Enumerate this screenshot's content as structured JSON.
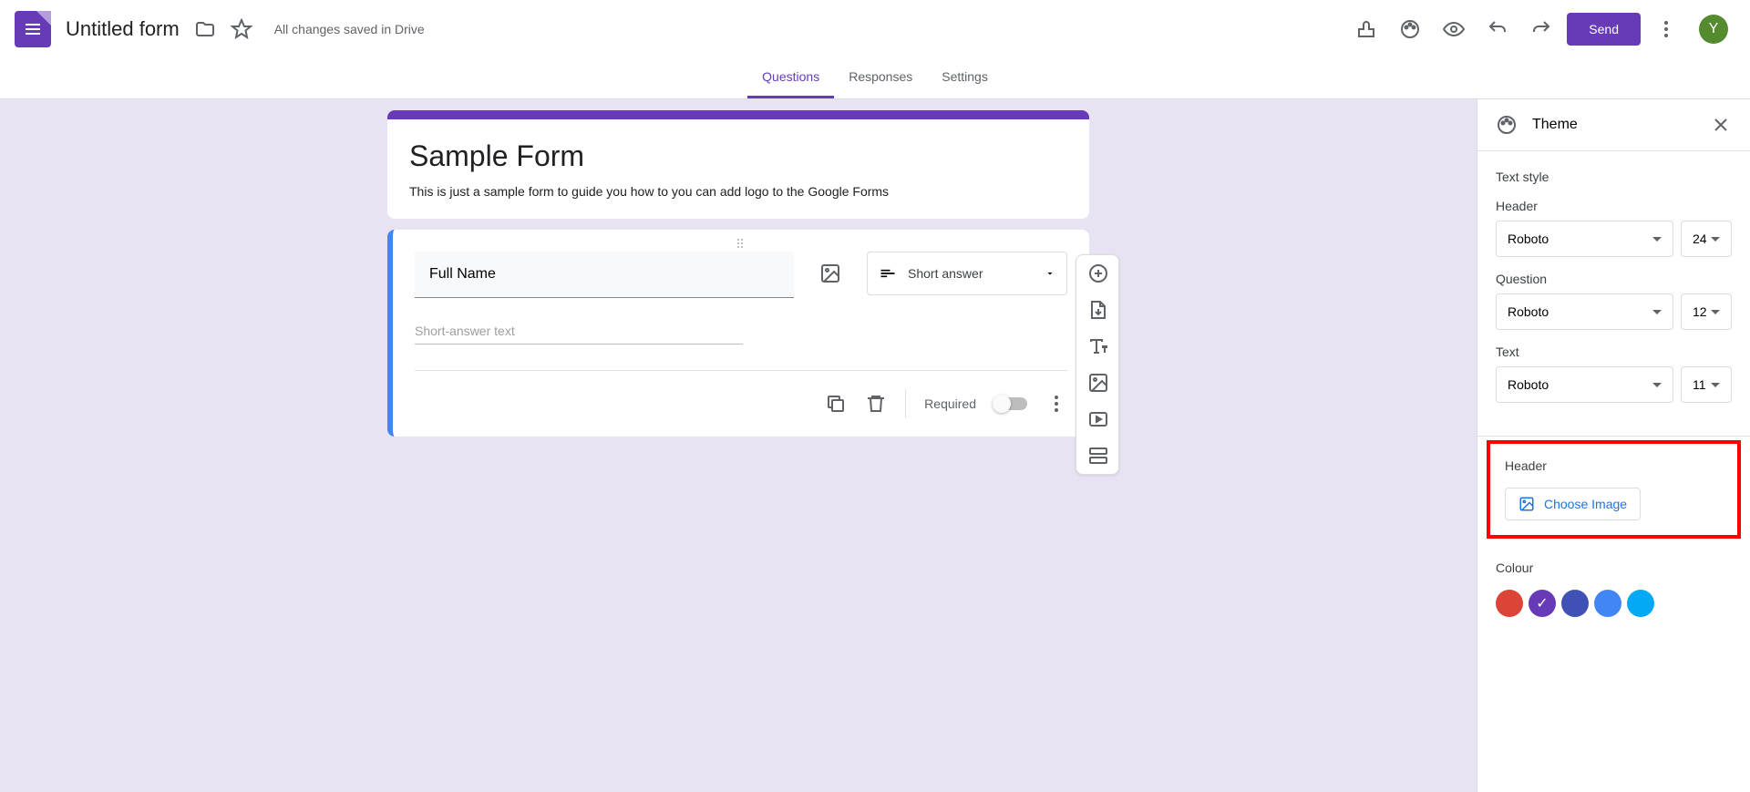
{
  "header": {
    "form_name": "Untitled form",
    "save_status": "All changes saved in Drive",
    "send_label": "Send",
    "avatar_letter": "Y"
  },
  "tabs": {
    "questions": "Questions",
    "responses": "Responses",
    "settings": "Settings"
  },
  "form": {
    "title": "Sample Form",
    "description": "This is just a sample form to guide you how to you can add logo to the Google Forms"
  },
  "question": {
    "label": "Full Name",
    "type": "Short answer",
    "placeholder": "Short-answer text",
    "required_label": "Required"
  },
  "theme": {
    "title": "Theme",
    "text_style_label": "Text style",
    "header_label": "Header",
    "header_font": "Roboto",
    "header_size": "24",
    "question_label": "Question",
    "question_font": "Roboto",
    "question_size": "12",
    "text_label": "Text",
    "text_font": "Roboto",
    "text_size": "11",
    "header_image_label": "Header",
    "choose_image": "Choose Image",
    "colour_label": "Colour",
    "swatch_colors": [
      "#db4437",
      "#673ab7",
      "#3f51b5",
      "#4285f4",
      "#03a9f4"
    ]
  }
}
